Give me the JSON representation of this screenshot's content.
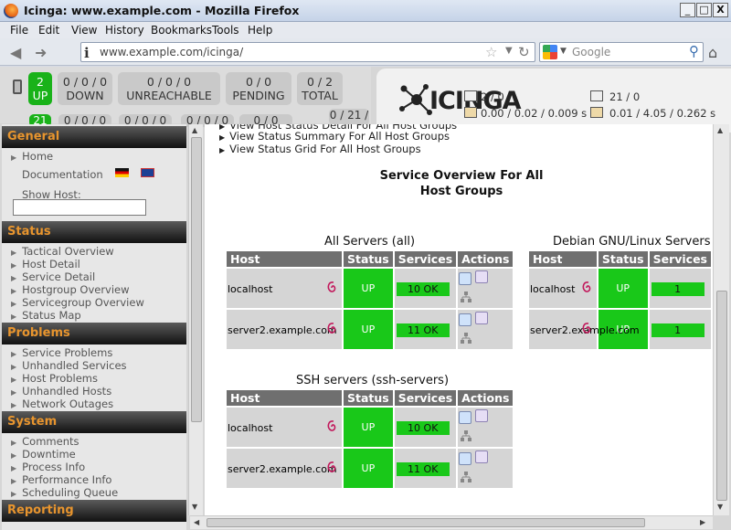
{
  "window": {
    "title": "Icinga: www.example.com - Mozilla Firefox",
    "buttons": [
      "_",
      "□",
      "X"
    ]
  },
  "menu": [
    "File",
    "Edit",
    "View",
    "History",
    "Bookmarks",
    "Tools",
    "Help"
  ],
  "nav": {
    "url": "www.example.com/icinga/",
    "search_placeholder": "Google"
  },
  "status_header": {
    "hosts": [
      {
        "count": "2",
        "label": "UP"
      },
      {
        "count": "0 / 0 / 0",
        "label": "DOWN"
      },
      {
        "count": "0 / 0 / 0",
        "label": "UNREACHABLE"
      },
      {
        "count": "0 / 0",
        "label": "PENDING"
      },
      {
        "count": "0 / 2",
        "label": "TOTAL"
      }
    ],
    "services_row": [
      "21",
      "0 / 0 / 0",
      "0 / 0 / 0",
      "0 / 0 / 0",
      "0 / 0",
      "0 / 21 /"
    ],
    "logo_text": "ICINGA",
    "perf": {
      "hosts_checked": "2 / 0",
      "hosts_latency": "0.00 / 0.02 / 0.009 s",
      "services_checked": "21 / 0",
      "services_latency": "0.01 / 4.05 / 0.262 s"
    }
  },
  "sidebar": {
    "general": {
      "title": "General",
      "home": "Home",
      "documentation": "Documentation",
      "show_host_label": "Show Host:"
    },
    "status": {
      "title": "Status",
      "items": [
        "Tactical Overview",
        "Host Detail",
        "Service Detail",
        "Hostgroup Overview",
        "Servicegroup Overview",
        "Status Map"
      ]
    },
    "problems": {
      "title": "Problems",
      "items": [
        "Service Problems",
        "Unhandled Services",
        "Host Problems",
        "Unhandled Hosts",
        "Network Outages"
      ]
    },
    "system": {
      "title": "System",
      "items": [
        "Comments",
        "Downtime",
        "Process Info",
        "Performance Info",
        "Scheduling Queue"
      ]
    },
    "reporting": {
      "title": "Reporting"
    }
  },
  "main": {
    "links": [
      "View Host Status Detail For All Host Groups",
      "View Status Summary For All Host Groups",
      "View Status Grid For All Host Groups"
    ],
    "page_title_line1": "Service Overview For All",
    "page_title_line2": "Host Groups",
    "columns": [
      "Host",
      "Status",
      "Services",
      "Actions"
    ],
    "groups": [
      {
        "title": "All Servers (all)",
        "rows": [
          {
            "host": "localhost",
            "status": "UP",
            "services": "10 OK"
          },
          {
            "host": "server2.example.com",
            "status": "UP",
            "services": "11 OK"
          }
        ]
      },
      {
        "title": "Debian GNU/Linux Servers (de",
        "rows": [
          {
            "host": "localhost",
            "status": "UP",
            "services": "1"
          },
          {
            "host": "server2.example.com",
            "status": "UP",
            "services": "1"
          }
        ]
      },
      {
        "title": "SSH servers (ssh-servers)",
        "rows": [
          {
            "host": "localhost",
            "status": "UP",
            "services": "10 OK"
          },
          {
            "host": "server2.example.com",
            "status": "UP",
            "services": "11 OK"
          }
        ]
      }
    ]
  },
  "icons": {
    "os": "debian-swirl-icon",
    "action1": "status-detail-icon",
    "action2": "host-info-icon",
    "action3": "status-map-icon"
  },
  "colors": {
    "up_green": "#19c819",
    "header_gray": "#6f6f6f",
    "section_orange": "#e8952e"
  }
}
